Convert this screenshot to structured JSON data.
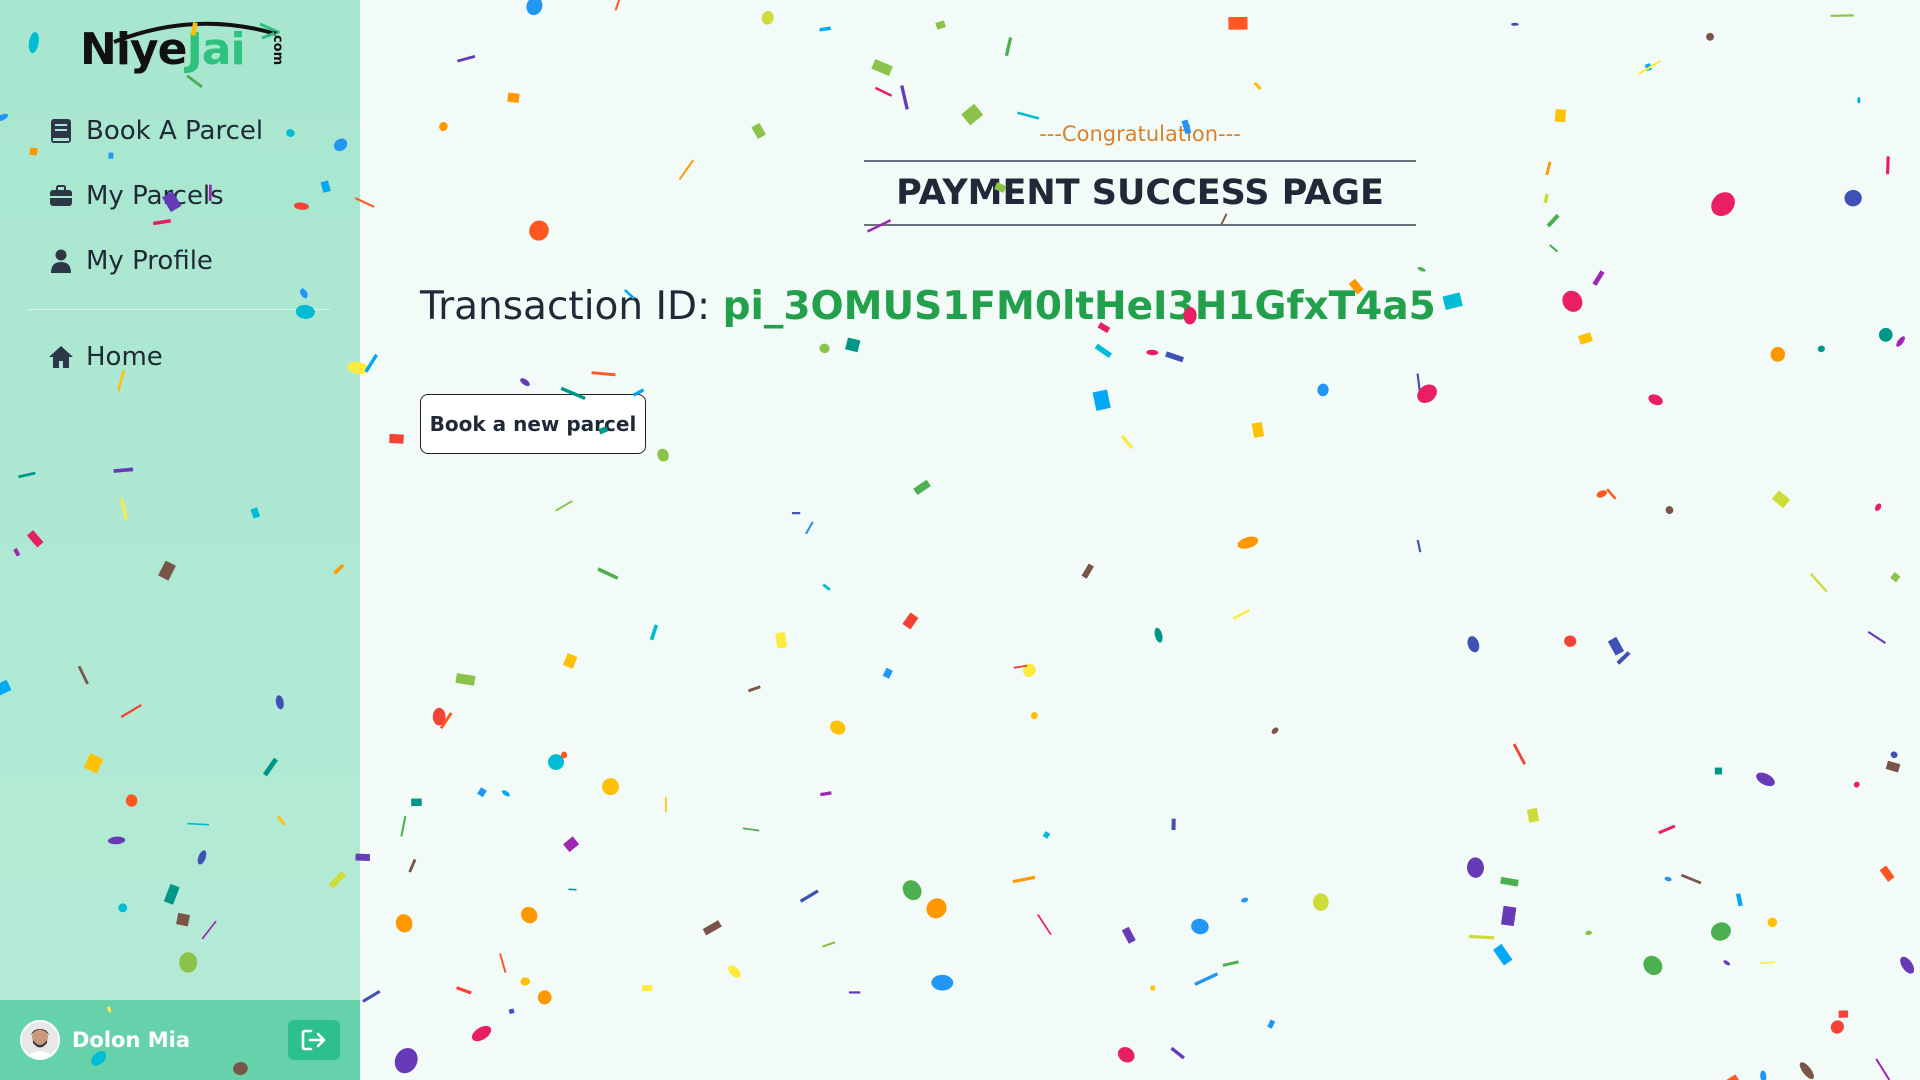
{
  "brand": {
    "logo_main": "NiyeJai",
    "logo_dark_part": "Niye",
    "logo_accent_part": "Jai",
    "logo_suffix": ".com"
  },
  "sidebar": {
    "items": [
      {
        "label": "Book A Parcel",
        "icon": "book-icon"
      },
      {
        "label": "My Parcels",
        "icon": "briefcase-icon"
      },
      {
        "label": "My Profile",
        "icon": "user-icon"
      }
    ],
    "home": {
      "label": "Home",
      "icon": "home-icon"
    }
  },
  "user": {
    "name": "Dolon Mia",
    "logout_icon": "logout-icon"
  },
  "main": {
    "congrats": "---Congratulation---",
    "title": "PAYMENT SUCCESS PAGE",
    "transaction_label": "Transaction ID:",
    "transaction_id": "pi_3OMUS1FM0ltHeI3H1GfxT4a5",
    "button_label": "Book a new parcel"
  },
  "colors": {
    "sidebar_bg": "#a8e6cf",
    "user_bar_bg": "#66d2ab",
    "accent_green": "#22a04b",
    "congrats_orange": "#d9822b"
  }
}
